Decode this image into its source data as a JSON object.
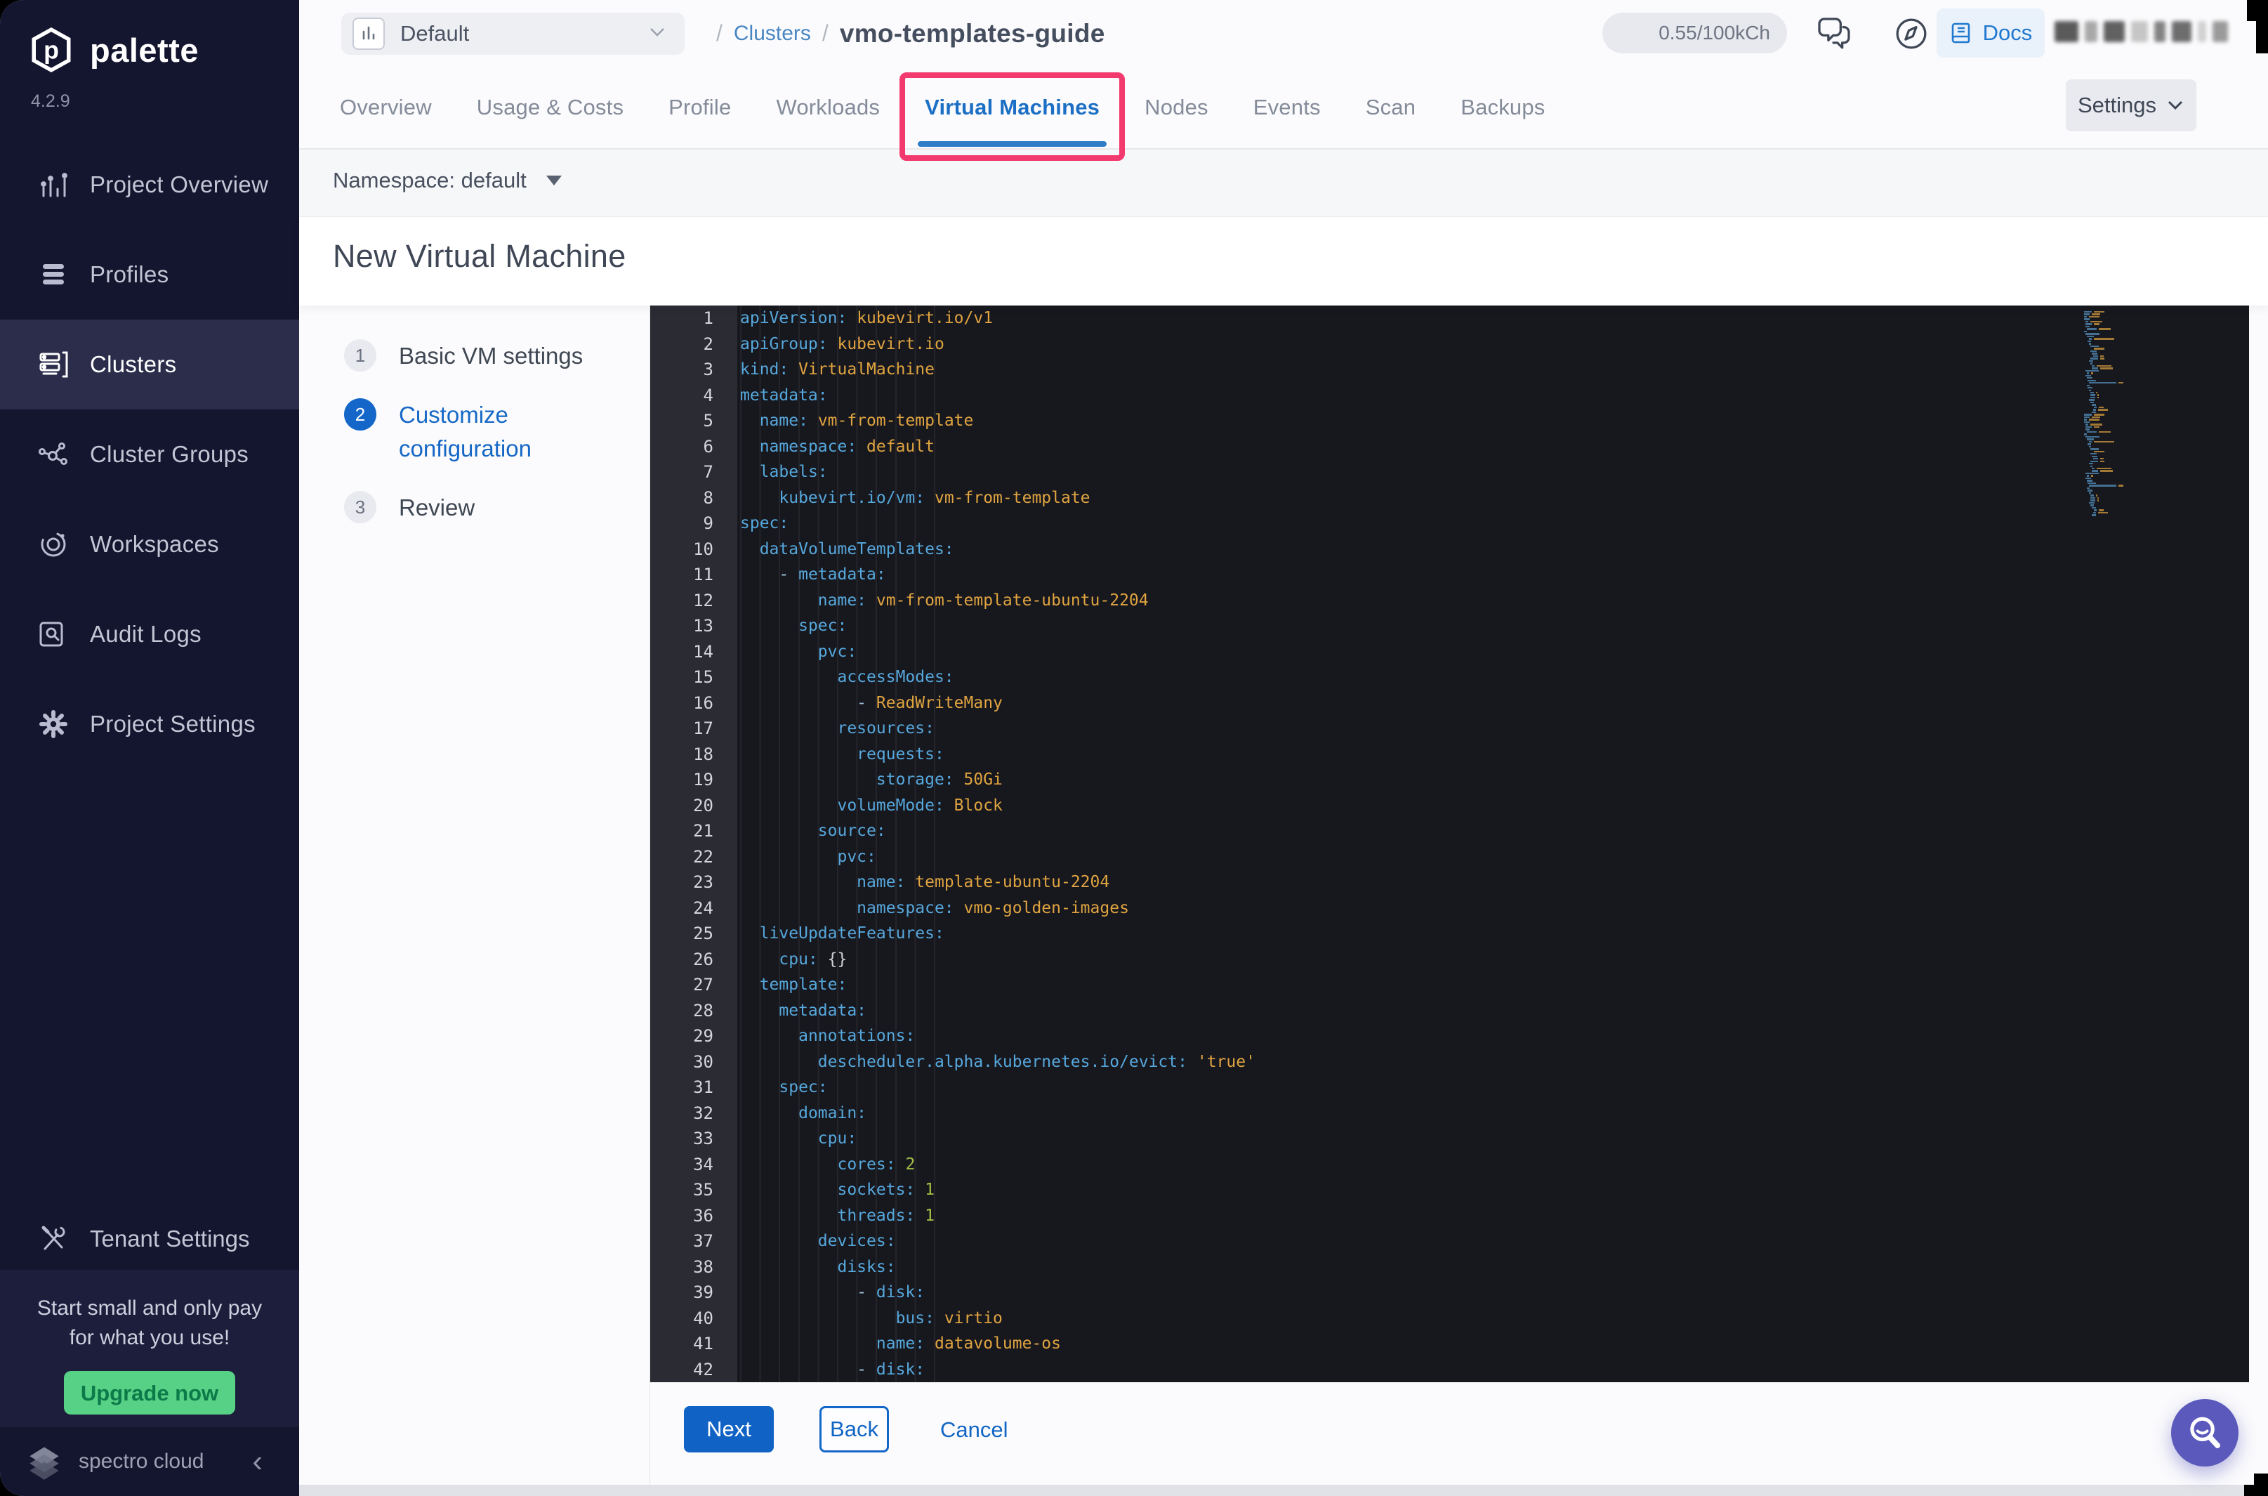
{
  "brand": {
    "logo_text": "palette",
    "version": "4.2.9",
    "footer_brand": "spectro cloud"
  },
  "sidebar": {
    "items": [
      {
        "icon": "bar-chart-icon",
        "label": "Project Overview",
        "active": false
      },
      {
        "icon": "layers-icon",
        "label": "Profiles",
        "active": false
      },
      {
        "icon": "server-icon",
        "label": "Clusters",
        "active": true
      },
      {
        "icon": "network-icon",
        "label": "Cluster Groups",
        "active": false
      },
      {
        "icon": "orbit-icon",
        "label": "Workspaces",
        "active": false
      },
      {
        "icon": "audit-icon",
        "label": "Audit Logs",
        "active": false
      },
      {
        "icon": "gear-icon",
        "label": "Project Settings",
        "active": false
      }
    ],
    "tenant_settings_label": "Tenant Settings",
    "upsell": {
      "text_line1": "Start small and only pay",
      "text_line2": "for what you use!",
      "button_label": "Upgrade now"
    }
  },
  "topbar": {
    "project_selector_value": "Default",
    "breadcrumb": {
      "sep": "/",
      "link": "Clusters",
      "current": "vmo-templates-guide"
    },
    "usage_badge": "0.55/100kCh",
    "docs_label": "Docs"
  },
  "tabs": {
    "items": [
      "Overview",
      "Usage & Costs",
      "Profile",
      "Workloads",
      "Virtual Machines",
      "Nodes",
      "Events",
      "Scan",
      "Backups"
    ],
    "active": "Virtual Machines",
    "settings_label": "Settings"
  },
  "toolbar": {
    "namespace_label": "Namespace: default"
  },
  "page": {
    "title": "New Virtual Machine"
  },
  "wizard": {
    "steps": [
      {
        "number": "1",
        "label": "Basic VM settings",
        "active": false
      },
      {
        "number": "2",
        "label": "Customize configuration",
        "active": true
      },
      {
        "number": "3",
        "label": "Review",
        "active": false
      }
    ]
  },
  "editor": {
    "lines": [
      "apiVersion: kubevirt.io/v1",
      "apiGroup: kubevirt.io",
      "kind: VirtualMachine",
      "metadata:",
      "  name: vm-from-template",
      "  namespace: default",
      "  labels:",
      "    kubevirt.io/vm: vm-from-template",
      "spec:",
      "  dataVolumeTemplates:",
      "    - metadata:",
      "        name: vm-from-template-ubuntu-2204",
      "      spec:",
      "        pvc:",
      "          accessModes:",
      "            - ReadWriteMany",
      "          resources:",
      "            requests:",
      "              storage: 50Gi",
      "          volumeMode: Block",
      "        source:",
      "          pvc:",
      "            name: template-ubuntu-2204",
      "            namespace: vmo-golden-images",
      "  liveUpdateFeatures:",
      "    cpu: {}",
      "  template:",
      "    metadata:",
      "      annotations:",
      "        descheduler.alpha.kubernetes.io/evict: 'true'",
      "    spec:",
      "      domain:",
      "        cpu:",
      "          cores: 2",
      "          sockets: 1",
      "          threads: 1",
      "        devices:",
      "          disks:",
      "            - disk:",
      "                bus: virtio",
      "              name: datavolume-os",
      "            - disk:"
    ]
  },
  "actions": {
    "next_label": "Next",
    "back_label": "Back",
    "cancel_label": "Cancel"
  },
  "colors": {
    "accent_blue": "#1467c8",
    "brand_navy": "#14152f",
    "highlight_pink": "#f23a6e",
    "upgrade_green": "#57d186",
    "editor_bg": "#17171e",
    "code_key": "#56a8dc",
    "code_value": "#dfa440",
    "code_number": "#a3bf45",
    "fab_purple": "#5b5abc"
  }
}
